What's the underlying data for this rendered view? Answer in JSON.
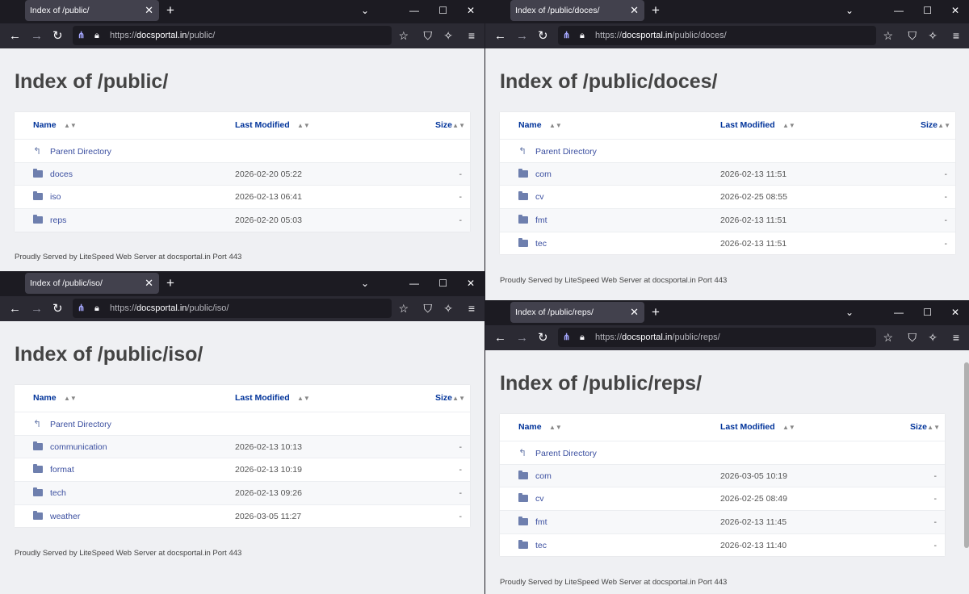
{
  "windows": [
    {
      "tab_title": "Index of /public/",
      "url_scheme": "https://",
      "url_host": "docsportal.in",
      "url_path": "/public/",
      "heading": "Index of /public/",
      "columns": {
        "name": "Name",
        "modified": "Last Modified",
        "size": "Size"
      },
      "parent": "Parent Directory",
      "rows": [
        {
          "name": "doces",
          "modified": "2026-02-20 05:22",
          "size": "-"
        },
        {
          "name": "iso",
          "modified": "2026-02-13 06:41",
          "size": "-"
        },
        {
          "name": "reps",
          "modified": "2026-02-20 05:03",
          "size": "-"
        }
      ],
      "footer": "Proudly Served by LiteSpeed Web Server at docsportal.in Port 443"
    },
    {
      "tab_title": "Index of /public/doces/",
      "url_scheme": "https://",
      "url_host": "docsportal.in",
      "url_path": "/public/doces/",
      "heading": "Index of /public/doces/",
      "columns": {
        "name": "Name",
        "modified": "Last Modified",
        "size": "Size"
      },
      "parent": "Parent Directory",
      "rows": [
        {
          "name": "com",
          "modified": "2026-02-13 11:51",
          "size": "-"
        },
        {
          "name": "cv",
          "modified": "2026-02-25 08:55",
          "size": "-"
        },
        {
          "name": "fmt",
          "modified": "2026-02-13 11:51",
          "size": "-"
        },
        {
          "name": "tec",
          "modified": "2026-02-13 11:51",
          "size": "-"
        }
      ],
      "footer": "Proudly Served by LiteSpeed Web Server at docsportal.in Port 443"
    },
    {
      "tab_title": "Index of /public/iso/",
      "url_scheme": "https://",
      "url_host": "docsportal.in",
      "url_path": "/public/iso/",
      "heading": "Index of /public/iso/",
      "columns": {
        "name": "Name",
        "modified": "Last Modified",
        "size": "Size"
      },
      "parent": "Parent Directory",
      "rows": [
        {
          "name": "communication",
          "modified": "2026-02-13 10:13",
          "size": "-"
        },
        {
          "name": "format",
          "modified": "2026-02-13 10:19",
          "size": "-"
        },
        {
          "name": "tech",
          "modified": "2026-02-13 09:26",
          "size": "-"
        },
        {
          "name": "weather",
          "modified": "2026-03-05 11:27",
          "size": "-"
        }
      ],
      "footer": "Proudly Served by LiteSpeed Web Server at docsportal.in Port 443"
    },
    {
      "tab_title": "Index of /public/reps/",
      "url_scheme": "https://",
      "url_host": "docsportal.in",
      "url_path": "/public/reps/",
      "heading": "Index of /public/reps/",
      "columns": {
        "name": "Name",
        "modified": "Last Modified",
        "size": "Size"
      },
      "parent": "Parent Directory",
      "rows": [
        {
          "name": "com",
          "modified": "2026-03-05 10:19",
          "size": "-"
        },
        {
          "name": "cv",
          "modified": "2026-02-25 08:49",
          "size": "-"
        },
        {
          "name": "fmt",
          "modified": "2026-02-13 11:45",
          "size": "-"
        },
        {
          "name": "tec",
          "modified": "2026-02-13 11:40",
          "size": "-"
        }
      ],
      "footer": "Proudly Served by LiteSpeed Web Server at docsportal.in Port 443"
    }
  ],
  "icons": {
    "back": "arrow-left-icon",
    "forward": "arrow-right-icon",
    "reload": "reload-icon",
    "lock": "lock-icon",
    "bookmark": "star-icon",
    "shield": "shield-icon",
    "extensions": "wand-icon",
    "menu": "hamburger-menu-icon",
    "folder": "folder-icon",
    "parent": "up-arrow-icon"
  },
  "colors": {
    "titlebar": "#1c1b22",
    "navbar": "#2b2a33",
    "tab": "#42414d",
    "page_bg": "#eff0f3",
    "link": "#3b4fa0",
    "folder": "#6e7fae"
  }
}
